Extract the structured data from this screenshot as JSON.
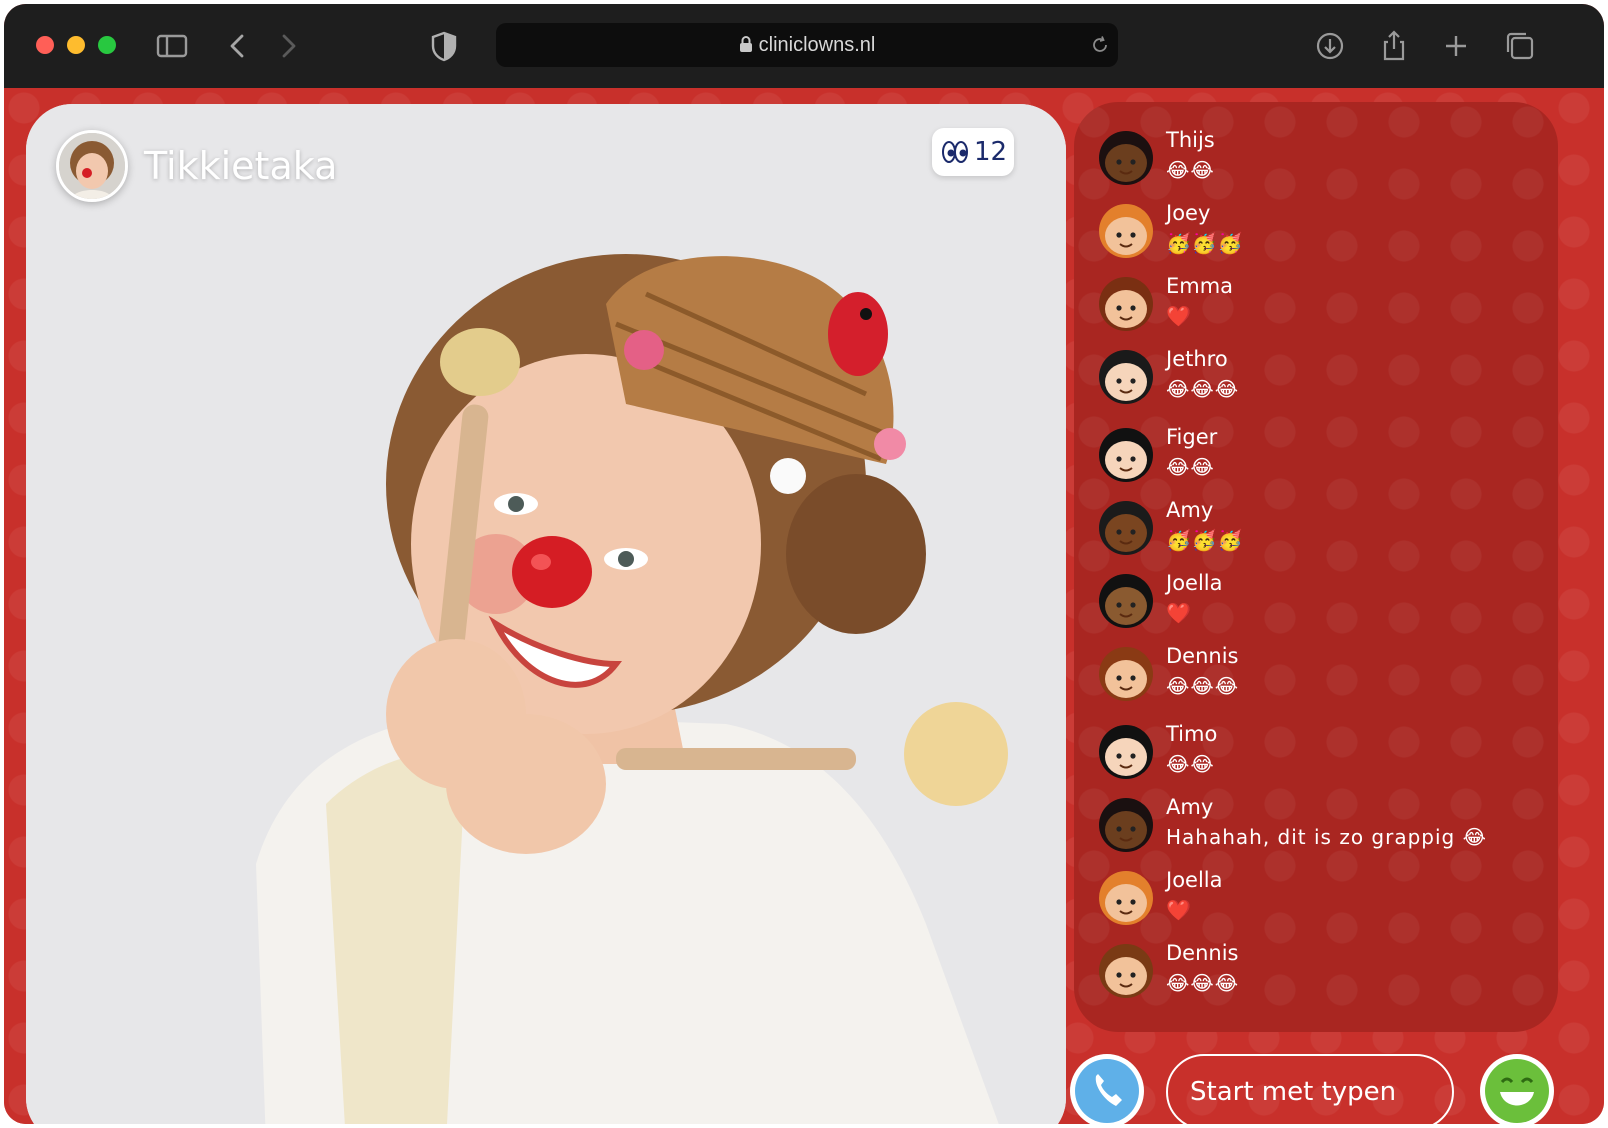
{
  "browser": {
    "url": "cliniclowns.nl",
    "colors": {
      "close": "#ff5f57",
      "minimize": "#febc2e",
      "maximize": "#28c840"
    },
    "icons": [
      "sidebar-icon",
      "back-icon",
      "forward-icon",
      "shield-icon",
      "lock-icon",
      "reload-icon",
      "download-icon",
      "share-icon",
      "new-tab-icon",
      "tabs-icon"
    ]
  },
  "stream": {
    "host_name": "Tikkietaka",
    "viewer_count": "12",
    "accent": "#c8302b"
  },
  "chat": {
    "messages": [
      {
        "name": "Thijs",
        "text": "😂😂"
      },
      {
        "name": "Joey",
        "text": "🥳🥳🥳"
      },
      {
        "name": "Emma",
        "text": "❤️"
      },
      {
        "name": "Jethro",
        "text": "😂😂😂"
      },
      {
        "name": "Figer",
        "text": "😂😂"
      },
      {
        "name": "Amy",
        "text": "🥳🥳🥳"
      },
      {
        "name": "Joella",
        "text": "❤️"
      },
      {
        "name": "Dennis",
        "text": "😂😂😂"
      },
      {
        "name": "Timo",
        "text": "😂😂"
      },
      {
        "name": "Amy",
        "text": "Hahahah, dit is zo grappig 😂"
      },
      {
        "name": "Joella",
        "text": "❤️"
      },
      {
        "name": "Dennis",
        "text": "😂😂😂"
      }
    ]
  },
  "composer": {
    "placeholder": "Start met typen"
  }
}
